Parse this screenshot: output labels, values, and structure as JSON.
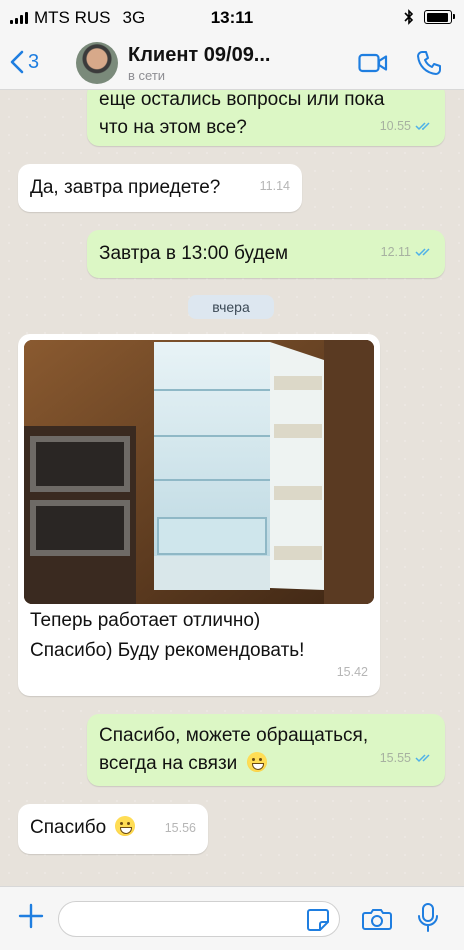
{
  "status_bar": {
    "carrier": "MTS RUS",
    "network": "3G",
    "time": "13:11"
  },
  "header": {
    "back_count": "3",
    "contact_name": "Клиент 09/09...",
    "contact_status": "в сети"
  },
  "messages": [
    {
      "direction": "out",
      "text_line1": "еще остались вопросы или пока",
      "text_line2": "что на этом все?",
      "time": "10.55"
    },
    {
      "direction": "in",
      "text": "Да, завтра приедете?",
      "time": "11.14"
    },
    {
      "direction": "out",
      "text": "Завтра в 13:00 будем",
      "time": "12.11"
    },
    {
      "direction": "in",
      "text_line1": "Теперь работает отлично)",
      "text_line2": "Спасибо) Буду рекомендовать!",
      "time": "15.42"
    },
    {
      "direction": "out",
      "text_line1": "Спасибо, можете обращаться,",
      "text_line2": "всегда на связи",
      "time": "15.55"
    },
    {
      "direction": "in",
      "text": "Спасибо",
      "time": "15.56"
    }
  ],
  "date_separator": "вчера",
  "input": {
    "value": "",
    "placeholder": ""
  },
  "colors": {
    "accent": "#1f7ee0",
    "outgoing_bubble": "#dcf7c5",
    "incoming_bubble": "#ffffff",
    "read_ticks": "#4fb1e8"
  }
}
